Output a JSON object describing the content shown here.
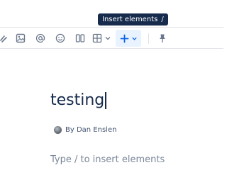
{
  "tooltip": {
    "label": "Insert elements",
    "shortcut": "/"
  },
  "toolbar": {
    "icons": [
      "link-icon",
      "image-icon",
      "mention-icon",
      "emoji-icon",
      "layout-icon",
      "table-icon",
      "chevron-down-icon",
      "plus-icon",
      "pin-icon"
    ]
  },
  "page": {
    "title": "testing",
    "byline": "By Dan Enslen",
    "body_placeholder": "Type / to insert elements"
  },
  "colors": {
    "accent": "#0c66e4",
    "accent_bg": "#e9f2ff",
    "tooltip_bg": "#172b4d"
  }
}
